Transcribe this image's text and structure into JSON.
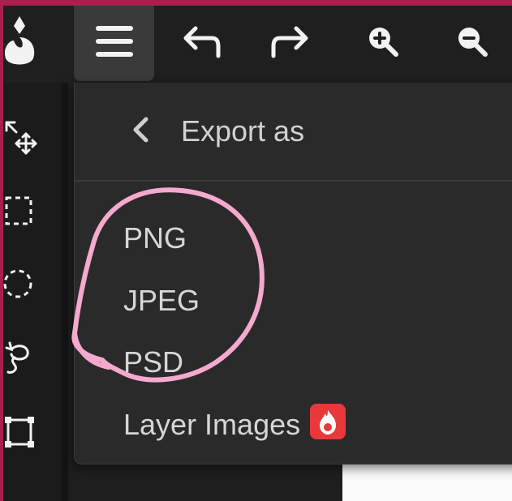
{
  "toolbar": {
    "icons": [
      "app-logo-icon",
      "menu-icon",
      "undo-icon",
      "redo-icon",
      "zoom-in-icon",
      "zoom-out-icon"
    ]
  },
  "tools": [
    "move-tool-icon",
    "rect-select-icon",
    "ellipse-select-icon",
    "lasso-icon",
    "transform-icon"
  ],
  "export_menu": {
    "title": "Export as",
    "items": [
      "PNG",
      "JPEG",
      "PSD",
      "Layer Images"
    ],
    "badge_icon": "flame-icon"
  },
  "colors": {
    "frame": "#a91f4d",
    "panel": "#2a2a2a",
    "text": "#d6d6d6",
    "badge": "#e8383a",
    "annotation": "#f5a9cf"
  }
}
